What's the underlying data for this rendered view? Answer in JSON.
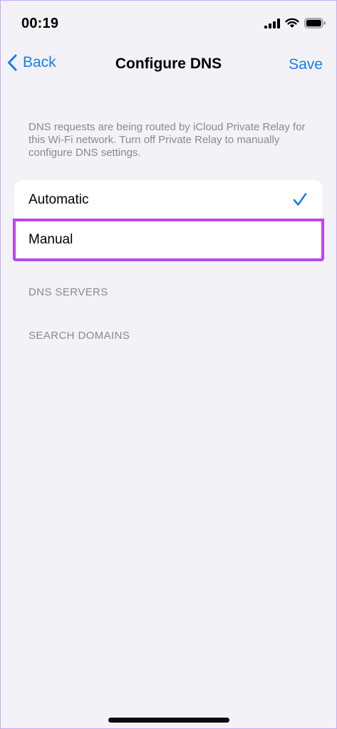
{
  "status_bar": {
    "time": "00:19"
  },
  "nav": {
    "back_label": "Back",
    "title": "Configure DNS",
    "save_label": "Save"
  },
  "info": {
    "text": "DNS requests are being routed by iCloud Private Relay for this Wi-Fi network. Turn off Private Relay to manually configure DNS settings."
  },
  "options": {
    "automatic": "Automatic",
    "manual": "Manual",
    "selected": "Automatic"
  },
  "sections": {
    "dns_servers": "DNS SERVERS",
    "search_domains": "SEARCH DOMAINS"
  },
  "colors": {
    "accent": "#1a7cf5",
    "highlight": "#b548f0",
    "background": "#f2f2f7"
  },
  "icons": {
    "back": "chevron-left-icon",
    "check": "checkmark-icon",
    "signal": "cellular-signal-icon",
    "wifi": "wifi-icon",
    "battery": "battery-icon"
  }
}
